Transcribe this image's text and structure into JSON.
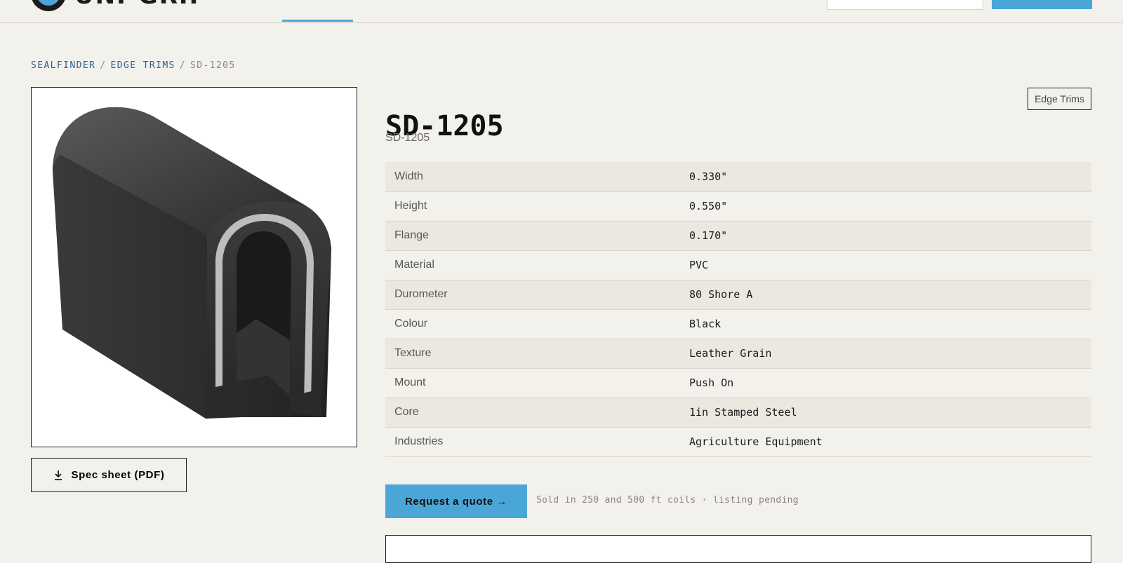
{
  "header": {
    "brand": "UNI-GRIP",
    "accent_color": "#4ba6d8"
  },
  "breadcrumb": {
    "items": [
      "SEALFINDER",
      "EDGE TRIMS"
    ],
    "current": "SD-1205",
    "separator": "/"
  },
  "product": {
    "title": "SD-1205",
    "subtitle": "SD-1205",
    "category": "Edge Trims",
    "image_icon": "edge-trim-profile",
    "specs": [
      {
        "label": "Width",
        "value": "0.330\""
      },
      {
        "label": "Height",
        "value": "0.550\""
      },
      {
        "label": "Flange",
        "value": "0.170\""
      },
      {
        "label": "Material",
        "value": "PVC"
      },
      {
        "label": "Durometer",
        "value": "80 Shore A"
      },
      {
        "label": "Colour",
        "value": "Black"
      },
      {
        "label": "Texture",
        "value": "Leather Grain"
      },
      {
        "label": "Mount",
        "value": "Push On"
      },
      {
        "label": "Core",
        "value": "1in Stamped Steel"
      },
      {
        "label": "Industries",
        "value": "Agriculture Equipment"
      }
    ]
  },
  "actions": {
    "spec_sheet_label": "Spec sheet (PDF)",
    "spec_sheet_icon": "download-icon",
    "quote_label": "Request a quote →",
    "availability_note": "Sold in 250 and 500 ft coils · listing pending"
  }
}
